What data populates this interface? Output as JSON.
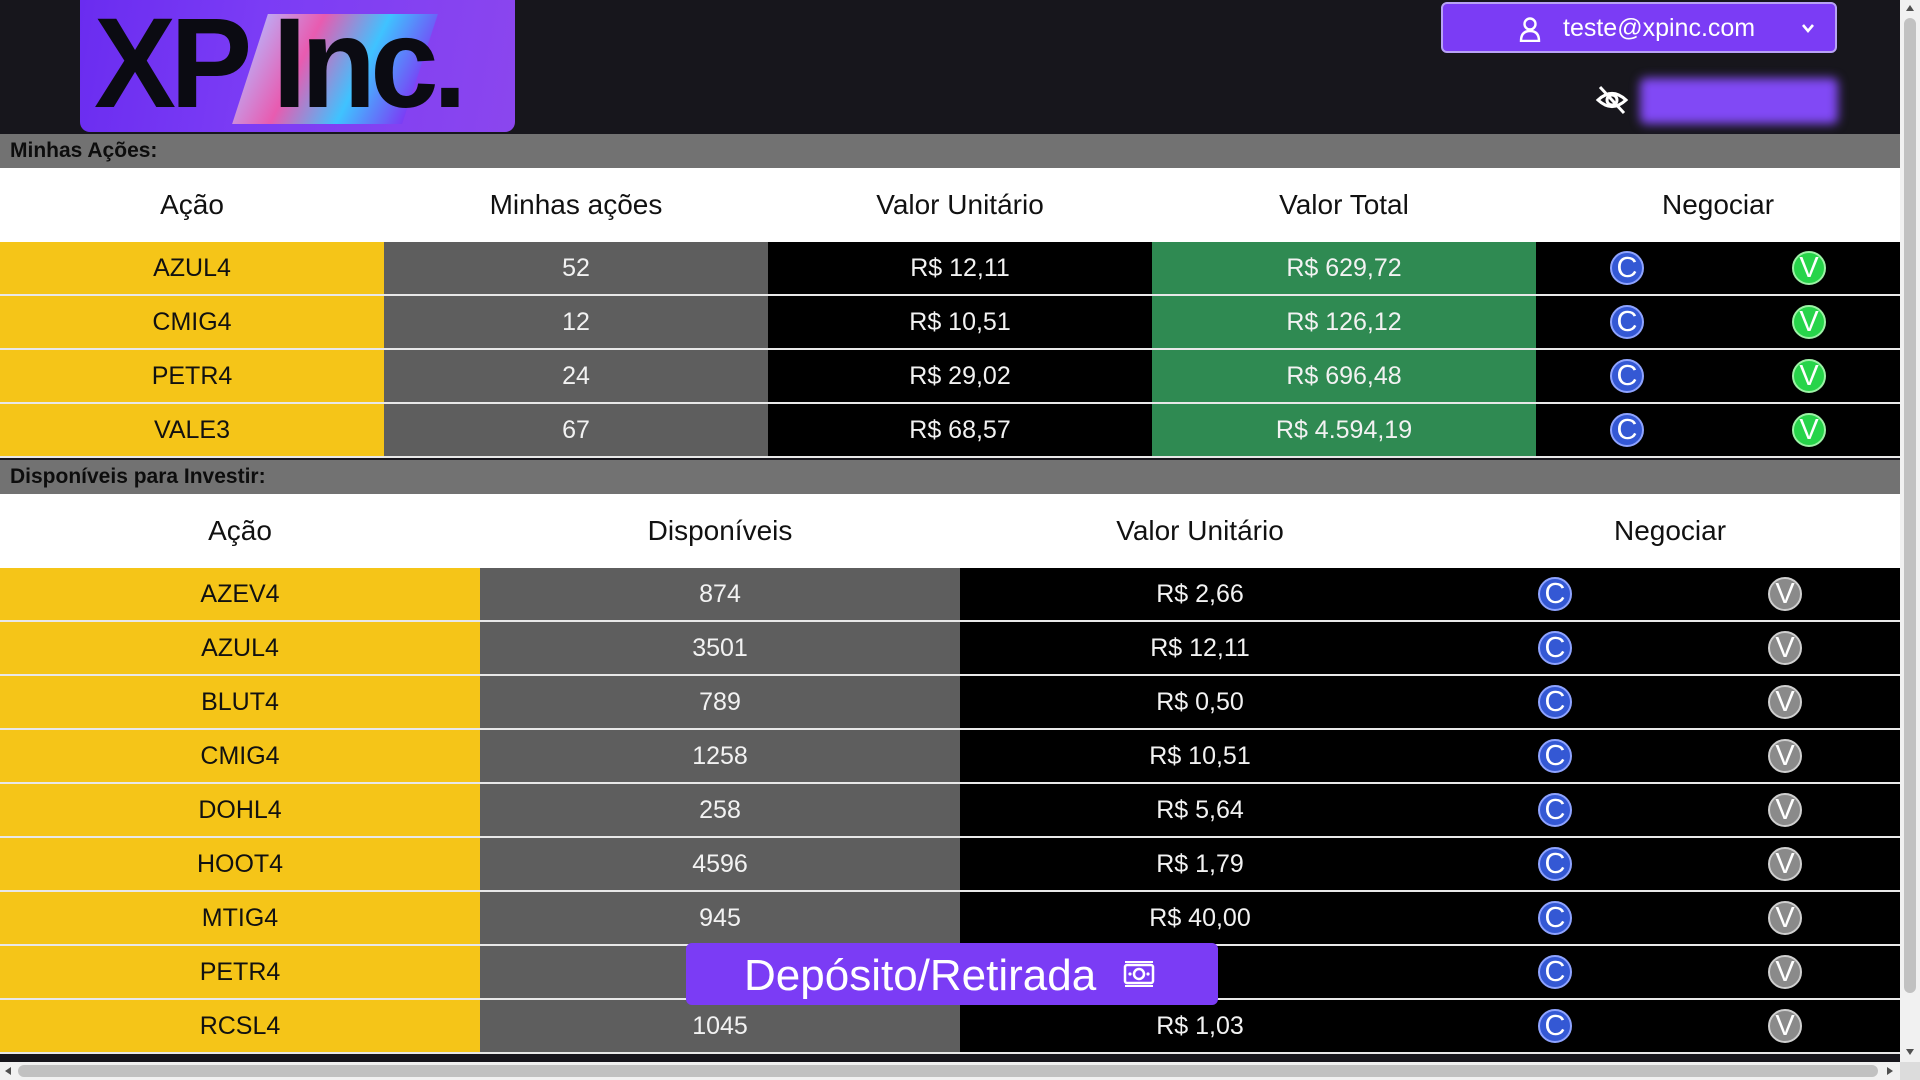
{
  "header": {
    "logo_text": "XP Inc.",
    "user_email": "teste@xpinc.com",
    "icons": [
      "user-icon",
      "chevron-down-icon",
      "eye-off-icon"
    ],
    "balance_hidden": true
  },
  "my_stocks": {
    "section_title": "Minhas Ações:",
    "columns": [
      "Ação",
      "Minhas ações",
      "Valor Unitário",
      "Valor Total",
      "Negociar"
    ],
    "rows": [
      {
        "ticker": "AZUL4",
        "qty": "52",
        "unit": "R$ 12,11",
        "total": "R$ 629,72"
      },
      {
        "ticker": "CMIG4",
        "qty": "12",
        "unit": "R$ 10,51",
        "total": "R$ 126,12"
      },
      {
        "ticker": "PETR4",
        "qty": "24",
        "unit": "R$ 29,02",
        "total": "R$ 696,48"
      },
      {
        "ticker": "VALE3",
        "qty": "67",
        "unit": "R$ 68,57",
        "total": "R$ 4.594,19"
      }
    ]
  },
  "available": {
    "section_title": "Disponíveis para Investir:",
    "columns": [
      "Ação",
      "Disponíveis",
      "Valor Unitário",
      "Negociar"
    ],
    "rows": [
      {
        "ticker": "AZEV4",
        "qty": "874",
        "unit": "R$ 2,66"
      },
      {
        "ticker": "AZUL4",
        "qty": "3501",
        "unit": "R$ 12,11"
      },
      {
        "ticker": "BLUT4",
        "qty": "789",
        "unit": "R$ 0,50"
      },
      {
        "ticker": "CMIG4",
        "qty": "1258",
        "unit": "R$ 10,51"
      },
      {
        "ticker": "DOHL4",
        "qty": "258",
        "unit": "R$ 5,64"
      },
      {
        "ticker": "HOOT4",
        "qty": "4596",
        "unit": "R$ 1,79"
      },
      {
        "ticker": "MTIG4",
        "qty": "945",
        "unit": "R$ 40,00"
      },
      {
        "ticker": "PETR4",
        "qty": "",
        "unit": "02"
      },
      {
        "ticker": "RCSL4",
        "qty": "1045",
        "unit": "R$ 1,03"
      }
    ]
  },
  "trade_buttons": {
    "buy": "C",
    "sell": "V"
  },
  "deposit_button": {
    "label": "Depósito/Retirada",
    "icon": "money-icon"
  },
  "colors": {
    "accent": "#7b3cf5",
    "ticker_bg": "#f5c518",
    "qty_bg": "#5e5e5e",
    "total_bg": "#2f8a52",
    "buy_button": "#3458d4",
    "sell_enabled": "#27d44a",
    "sell_disabled": "#8a8a8a"
  }
}
